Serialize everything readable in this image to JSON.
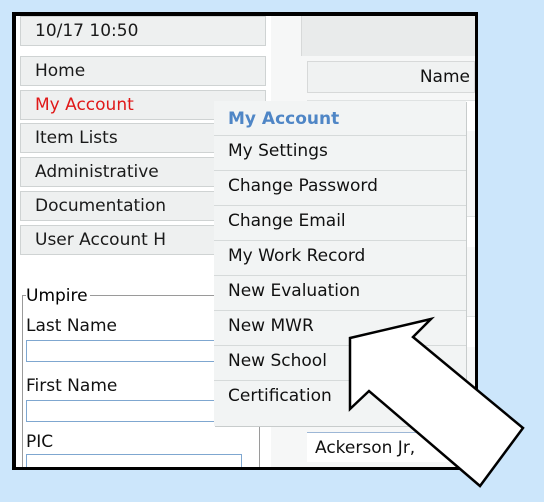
{
  "sidebar": {
    "datetime": "10/17 10:50",
    "items": [
      "Home",
      "My Account",
      "Item Lists",
      "Administrative",
      "Documentation",
      "User Account H"
    ]
  },
  "umpire": {
    "legend": "Umpire",
    "fields": [
      "Last Name",
      "First Name",
      "PIC"
    ]
  },
  "main": {
    "name_column": "Name",
    "result_row": "Ackerson Jr,"
  },
  "dropdown": {
    "header": "My Account",
    "items": [
      "My Settings",
      "Change Password",
      "Change Email",
      "My Work Record",
      "New Evaluation",
      "New MWR",
      "New School",
      "Certification"
    ]
  },
  "colors": {
    "active_nav": "#e01818",
    "menu_header": "#4f86c6",
    "background": "#cce6fb"
  },
  "annotation": {
    "icon": "arrow-pointer-icon"
  }
}
